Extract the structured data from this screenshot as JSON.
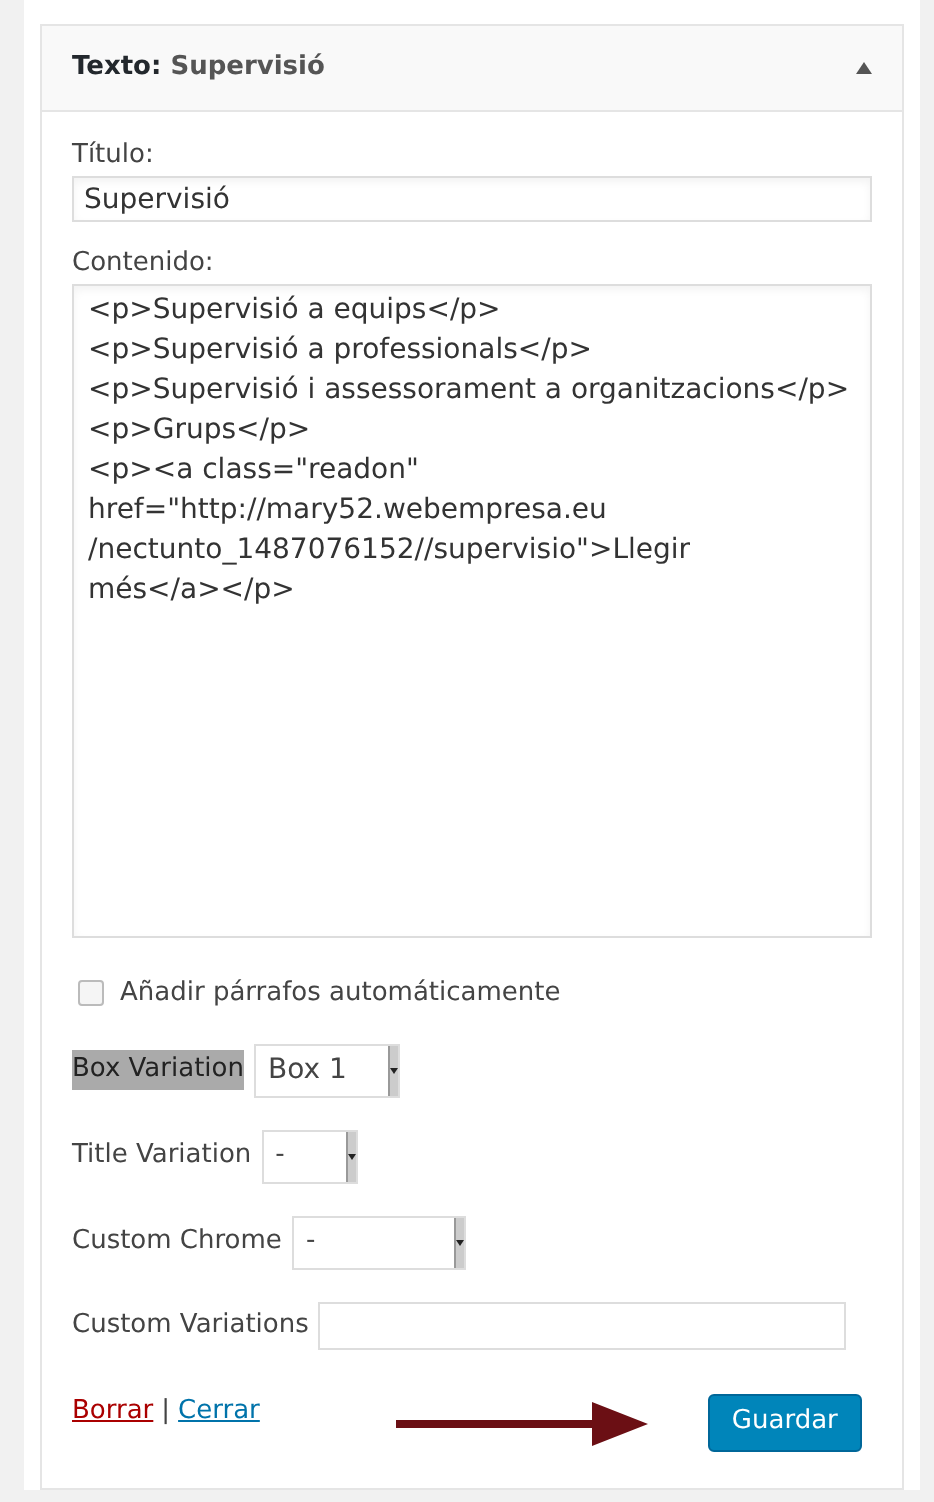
{
  "widget": {
    "type_label": "Texto:",
    "title": "Supervisió",
    "expanded": true
  },
  "fields": {
    "title_label": "Título:",
    "title_value": "Supervisió",
    "content_label": "Contenido:",
    "content_value": "<p>Supervisió a equips</p>\n<p>Supervisió a professionals</p>\n<p>Supervisió i assessorament a organitzacions</p>\n<p>Grups</p>\n<p><a class=\"readon\"\nhref=\"http://mary52.webempresa.eu\n/nectunto_1487076152//supervisio\">Llegir\nmés</a></p>"
  },
  "auto_paragraphs": {
    "label": "Añadir párrafos automáticamente",
    "checked": false
  },
  "options": [
    {
      "kind": "select",
      "label": "Box Variation",
      "value": "Box 1",
      "highlighted": true
    },
    {
      "kind": "select",
      "label": "Title Variation",
      "value": "-",
      "highlighted": false
    },
    {
      "kind": "select",
      "label": "Custom Chrome",
      "value": "-",
      "highlighted": false
    },
    {
      "kind": "text",
      "label": "Custom Variations",
      "highlighted": false
    }
  ],
  "footer": {
    "delete_link": "Borrar",
    "separator": "|",
    "close_link": "Cerrar",
    "save_button": "Guardar"
  }
}
